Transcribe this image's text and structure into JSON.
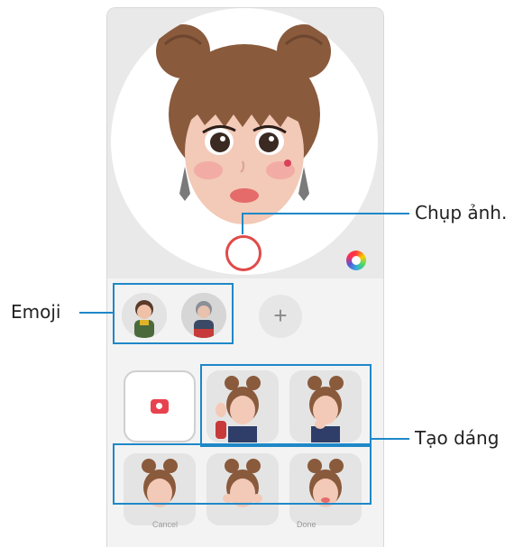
{
  "callouts": {
    "capture": "Chụp ảnh.",
    "emoji": "Emoji",
    "pose": "Tạo dáng"
  },
  "add_emoji_symbol": "+",
  "bottom": {
    "cancel": "Cancel",
    "done": "Done"
  },
  "colors": {
    "callout_line": "#1e88c8",
    "shutter_ring": "#e04a4a",
    "camera_icon": "#e8424f"
  }
}
